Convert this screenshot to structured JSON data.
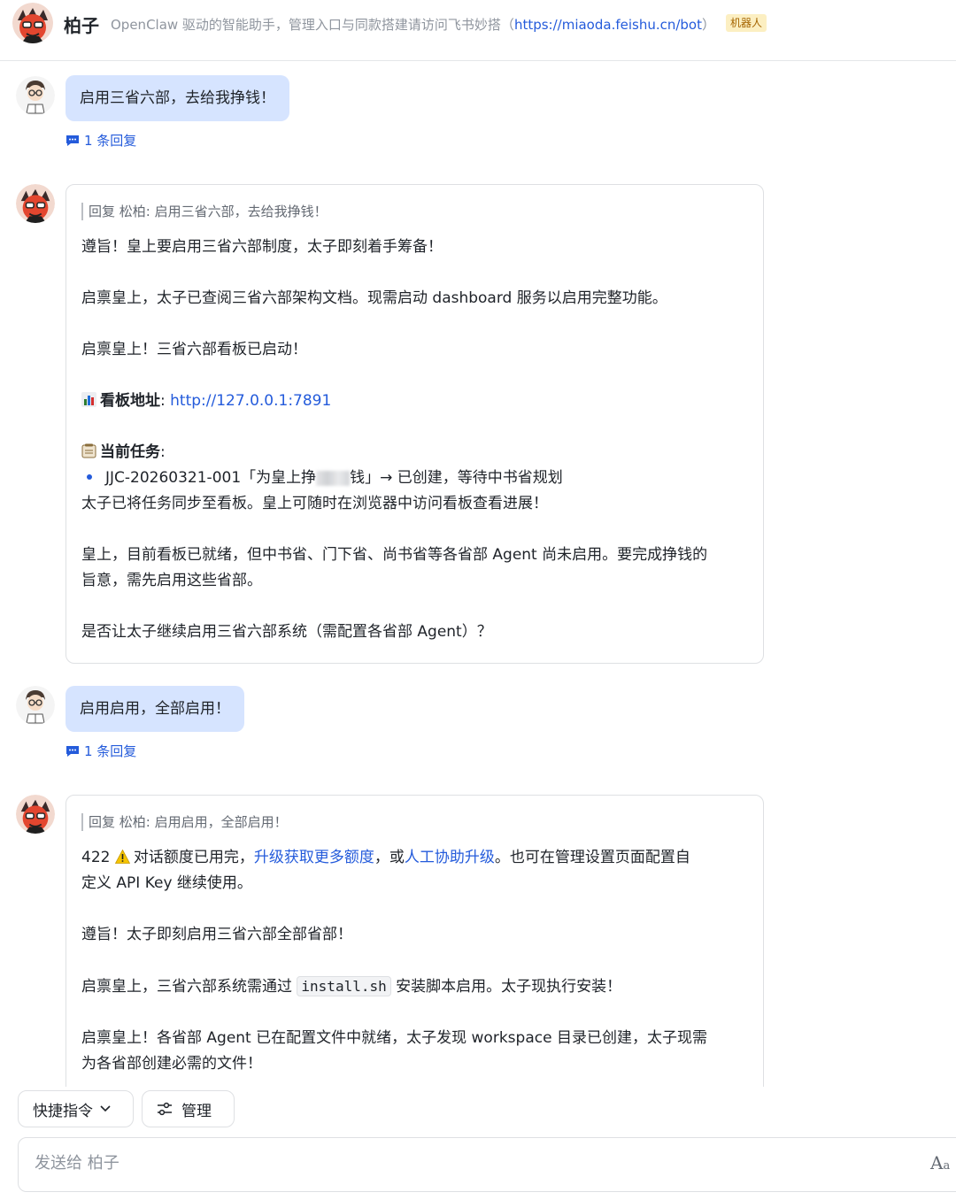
{
  "header": {
    "bot_name": "柏子",
    "description_prefix": "OpenClaw 驱动的智能助手，管理入口与同款搭建请访问飞书妙搭（",
    "description_link": "https://miaoda.feishu.cn/bot",
    "description_suffix": "）",
    "badge": "机器人"
  },
  "messages": [
    {
      "type": "user",
      "text": "启用三省六部，去给我挣钱！",
      "reply_count_label": "1 条回复"
    },
    {
      "type": "bot",
      "quote": "回复 松柏: 启用三省六部，去给我挣钱！",
      "lines": {
        "l1": "遵旨！皇上要启用三省六部制度，太子即刻着手筹备！",
        "l2": "启禀皇上，太子已查阅三省六部架构文档。现需启动 dashboard 服务以启用完整功能。",
        "l3": "启禀皇上！三省六部看板已启动！",
        "board_label": "看板地址",
        "board_colon": ":",
        "board_url": "http://127.0.0.1:7891",
        "task_label": "当前任务",
        "task_colon": ":",
        "task_pre": "JJC-20260321-001「为皇上挣",
        "task_post": "钱」→ 已创建，等待中书省规划",
        "l5": "太子已将任务同步至看板。皇上可随时在浏览器中访问看板查看进展！",
        "l6a": "皇上，目前看板已就绪，但中书省、门下省、尚书省等各省部 Agent 尚未启用。要完成挣钱的",
        "l6b": "旨意，需先启用这些省部。",
        "l7": "是否让太子继续启用三省六部系统（需配置各省部 Agent）？"
      }
    },
    {
      "type": "user",
      "text": "启用启用，全部启用！",
      "reply_count_label": "1 条回复"
    },
    {
      "type": "bot",
      "quote": "回复 松柏: 启用启用，全部启用！",
      "lines": {
        "err_code": "422",
        "err_text": "对话额度已用完，",
        "upgrade_link": "升级获取更多额度",
        "sep": "，或",
        "manual_link": "人工协助升级",
        "err_tail": "。也可在管理设置页面配置自",
        "err_line2": "定义 API Key 继续使用。",
        "l2": "遵旨！太子即刻启用三省六部全部省部！",
        "l3_pre": "启禀皇上，三省六部系统需通过 ",
        "l3_code": "install.sh",
        "l3_post": " 安装脚本启用。太子现执行安装！",
        "l4a": "启禀皇上！各省部 Agent 已在配置文件中就绪，太子发现 workspace 目录已创建，太子现需",
        "l4b": "为各省部创建必需的文件！"
      }
    }
  ],
  "toolbar": {
    "quick_commands": "快捷指令",
    "manage": "管理"
  },
  "composer": {
    "placeholder": "发送给 柏子",
    "font_button_big": "A",
    "font_button_small": "a"
  }
}
